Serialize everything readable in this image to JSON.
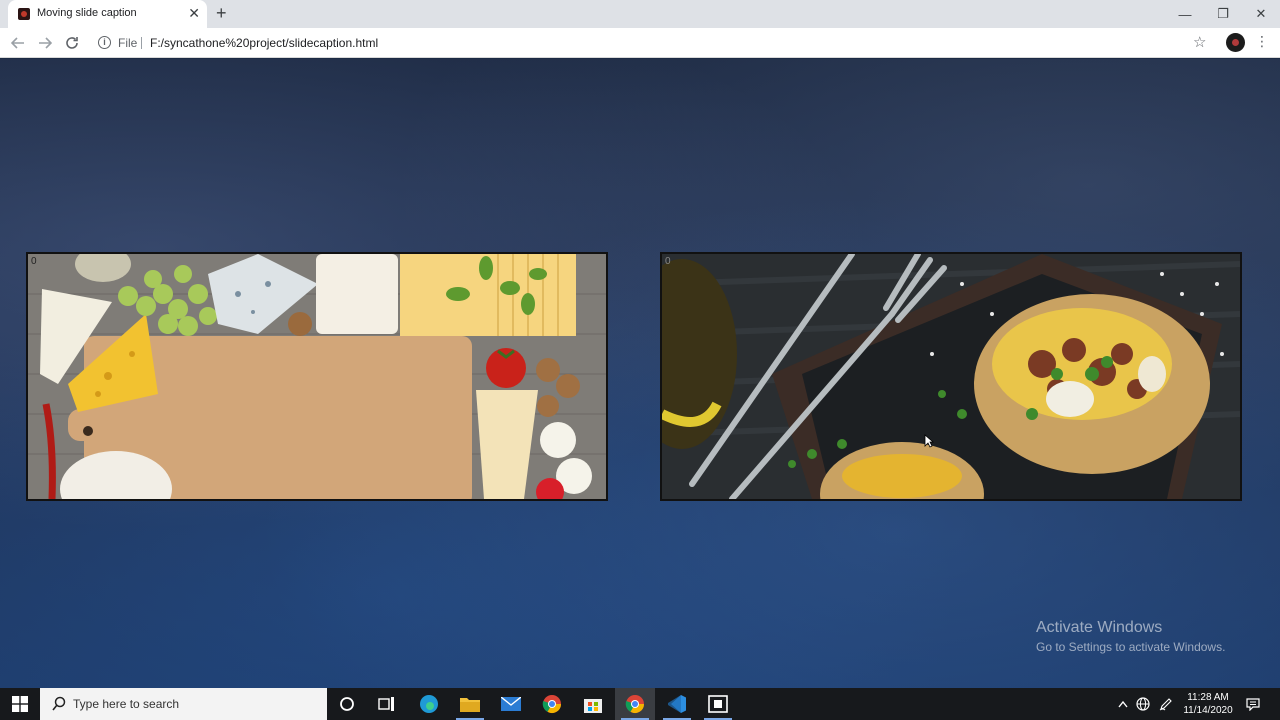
{
  "browser": {
    "tab_title": "Moving slide caption",
    "tab_close": "✕",
    "new_tab": "+",
    "scheme": "File",
    "url": "F:/syncathone%20project/slidecaption.html",
    "window_controls": {
      "minimize": "—",
      "restore": "❐",
      "close": "✕"
    }
  },
  "page": {
    "slides": [
      {
        "index_label": "0",
        "image": "cheese-board-photo"
      },
      {
        "index_label": "0",
        "image": "baked-potato-photo"
      }
    ]
  },
  "watermark": {
    "title": "Activate Windows",
    "subtitle": "Go to Settings to activate Windows."
  },
  "taskbar": {
    "search_placeholder": "Type here to search",
    "apps": [
      "cortana-icon",
      "task-view-icon",
      "edge-icon",
      "file-explorer-icon",
      "mail-icon",
      "chrome-icon",
      "store-icon",
      "chrome-active-icon",
      "vscode-icon",
      "snip-icon"
    ],
    "time": "11:28 AM",
    "date": "11/14/2020"
  },
  "colors": {
    "page_background": "#1e3258",
    "taskbar": "#17191c",
    "tabbar": "#dee1e6"
  }
}
